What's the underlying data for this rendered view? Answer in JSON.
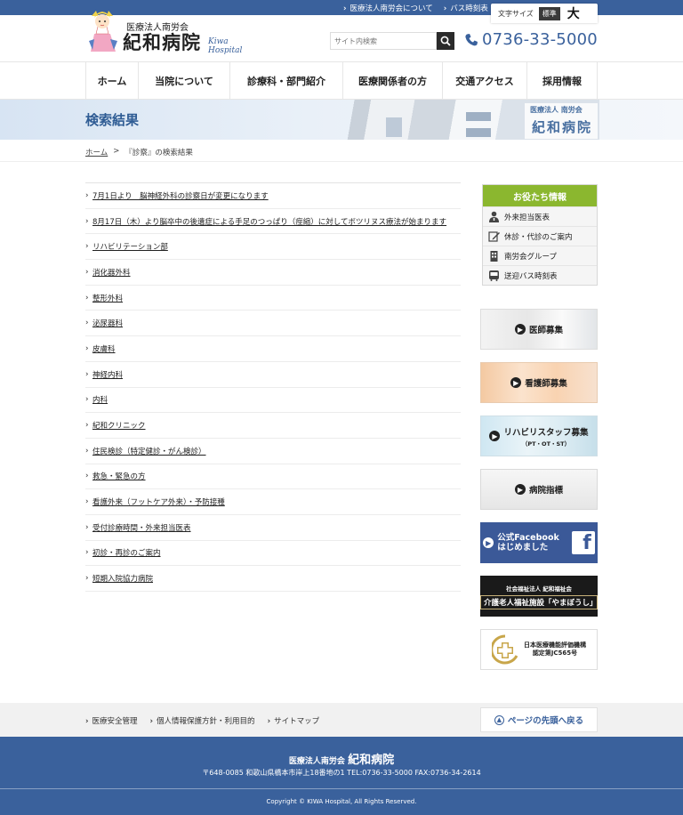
{
  "topbar": {
    "links": [
      "医療法人南労会について",
      "バス時刻表"
    ],
    "fontsize_label": "文字サイズ",
    "fontsize_standard": "標準",
    "fontsize_large": "大"
  },
  "header": {
    "corp_name": "医療法人南労会",
    "hospital_name": "紀和病院",
    "hospital_name_en": "Kiwa Hospital",
    "search_placeholder": "サイト内検索",
    "phone": "0736-33-5000"
  },
  "nav": {
    "items": [
      "ホーム",
      "当院について",
      "診療科・部門紹介",
      "医療関係者の方",
      "交通アクセス",
      "採用情報"
    ]
  },
  "banner": {
    "title": "検索結果",
    "sign_line1": "医療法人 南労会",
    "sign_line2": "紀和病院"
  },
  "breadcrumb": {
    "home": "ホーム",
    "separator": ">",
    "current": "『診察』の検索結果"
  },
  "results": [
    "7月1日より　脳神経外科の診察日が変更になります",
    "8月17日（木）より脳卒中の後遺症による手足のつっぱり（痙縮）に対してボツリヌス療法が始まります",
    "リハビリテーション部",
    "消化器外科",
    "整形外科",
    "泌尿器科",
    "皮膚科",
    "神経内科",
    "内科",
    "紀和クリニック",
    "住民検診（特定健診・がん検診）",
    "救急・緊急の方",
    "看護外来（フットケア外来）・予防接種",
    "受付診療時間・外来担当医表",
    "初診・再診のご案内",
    "短期入院協力病院"
  ],
  "sidebar": {
    "useful_title": "お役たち情報",
    "useful_items": [
      {
        "label": "外来担当医表",
        "icon": "doctor-icon"
      },
      {
        "label": "休診・代診のご案内",
        "icon": "edit-icon"
      },
      {
        "label": "南労会グループ",
        "icon": "building-icon"
      },
      {
        "label": "送迎バス時刻表",
        "icon": "bus-icon"
      }
    ],
    "banners": {
      "doctor_recruit": "医師募集",
      "nurse_recruit": "看護師募集",
      "rehab_recruit": "リハビリスタッフ募集",
      "rehab_recruit_sub": "（PT・OT・ST）",
      "hospital_index": "病院指標",
      "facebook_line1": "公式Facebook",
      "facebook_line2": "はじめました",
      "facebook_logo": "f",
      "yamaboushi_line1": "社会福祉法人 紀和福祉会",
      "yamaboushi_line2": "介護老人福祉施設「やまぼうし」",
      "jcqhc_line1": "日本医療機能評価機構",
      "jcqhc_line2": "認定第JC565号"
    }
  },
  "subfooter": {
    "links": [
      "医療安全管理",
      "個人情報保護方針・利用目的",
      "サイトマップ"
    ],
    "back_to_top": "ページの先頭へ戻る"
  },
  "footer": {
    "corp": "医療法人南労会",
    "name": "紀和病院",
    "address": "〒648-0085 和歌山県橋本市岸上18番地の1 TEL:0736-33-5000 FAX:0736-34-2614",
    "copyright": "Copyright © KIWA Hospital, All Rights Reserved."
  },
  "colors": {
    "brand_blue": "#3a619c",
    "accent_green": "#8bb72f",
    "facebook_blue": "#3b5998"
  }
}
